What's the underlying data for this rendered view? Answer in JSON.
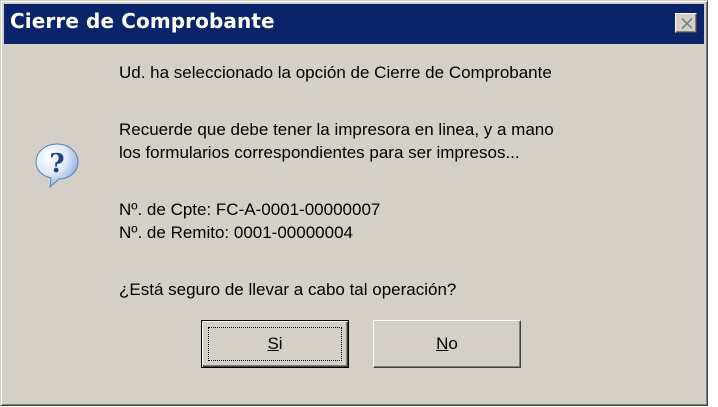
{
  "dialog": {
    "title": "Cierre de Comprobante",
    "icon": "question-icon",
    "close_icon": "close-icon"
  },
  "message": {
    "line1": "Ud. ha seleccionado la opción de Cierre de Comprobante",
    "line2": "Recuerde que debe tener la impresora en linea, y a mano",
    "line3": "los formularios correspondientes para ser impresos...",
    "line4": "Nº. de Cpte: FC-A-0001-00000007",
    "line5": "Nº. de Remito: 0001-00000004",
    "line6": "¿Está seguro de llevar a cabo tal operación?"
  },
  "buttons": {
    "yes": {
      "mnemonic": "S",
      "rest": "i"
    },
    "no": {
      "mnemonic": "N",
      "rest": "o"
    }
  },
  "colors": {
    "titlebar": "#0a246a",
    "face": "#d4d0c8",
    "icon_blue": "#2a5db0"
  }
}
